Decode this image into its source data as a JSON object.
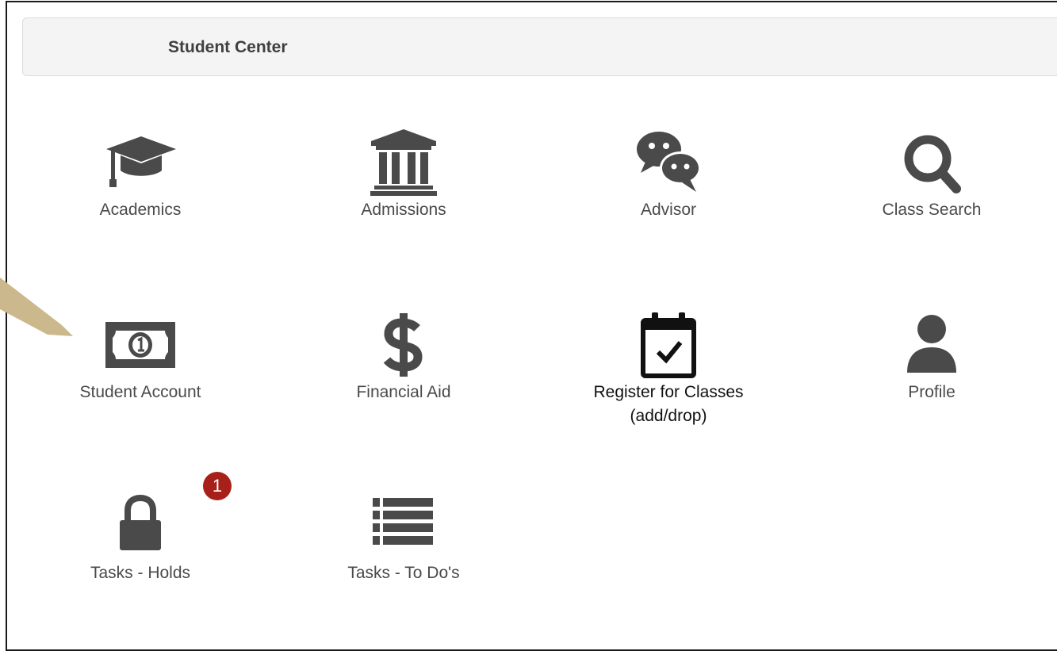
{
  "header": {
    "title": "Student Center"
  },
  "tiles": [
    {
      "label": "Academics",
      "icon": "graduation-cap-icon"
    },
    {
      "label": "Admissions",
      "icon": "bank-icon"
    },
    {
      "label": "Advisor",
      "icon": "chat-bubbles-icon"
    },
    {
      "label": "Class Search",
      "icon": "search-icon"
    },
    {
      "label": "Student Account",
      "icon": "money-bill-icon"
    },
    {
      "label": "Financial Aid",
      "icon": "dollar-icon"
    },
    {
      "label": "Register for Classes",
      "label2": "(add/drop)",
      "icon": "calendar-check-icon"
    },
    {
      "label": "Profile",
      "icon": "user-icon"
    },
    {
      "label": "Tasks - Holds",
      "icon": "lock-icon",
      "badge": "1"
    },
    {
      "label": "Tasks - To Do's",
      "icon": "list-icon"
    }
  ],
  "colors": {
    "icon": "#4a4a4a",
    "badge": "#a8201a",
    "arrow": "#c8b68a"
  }
}
